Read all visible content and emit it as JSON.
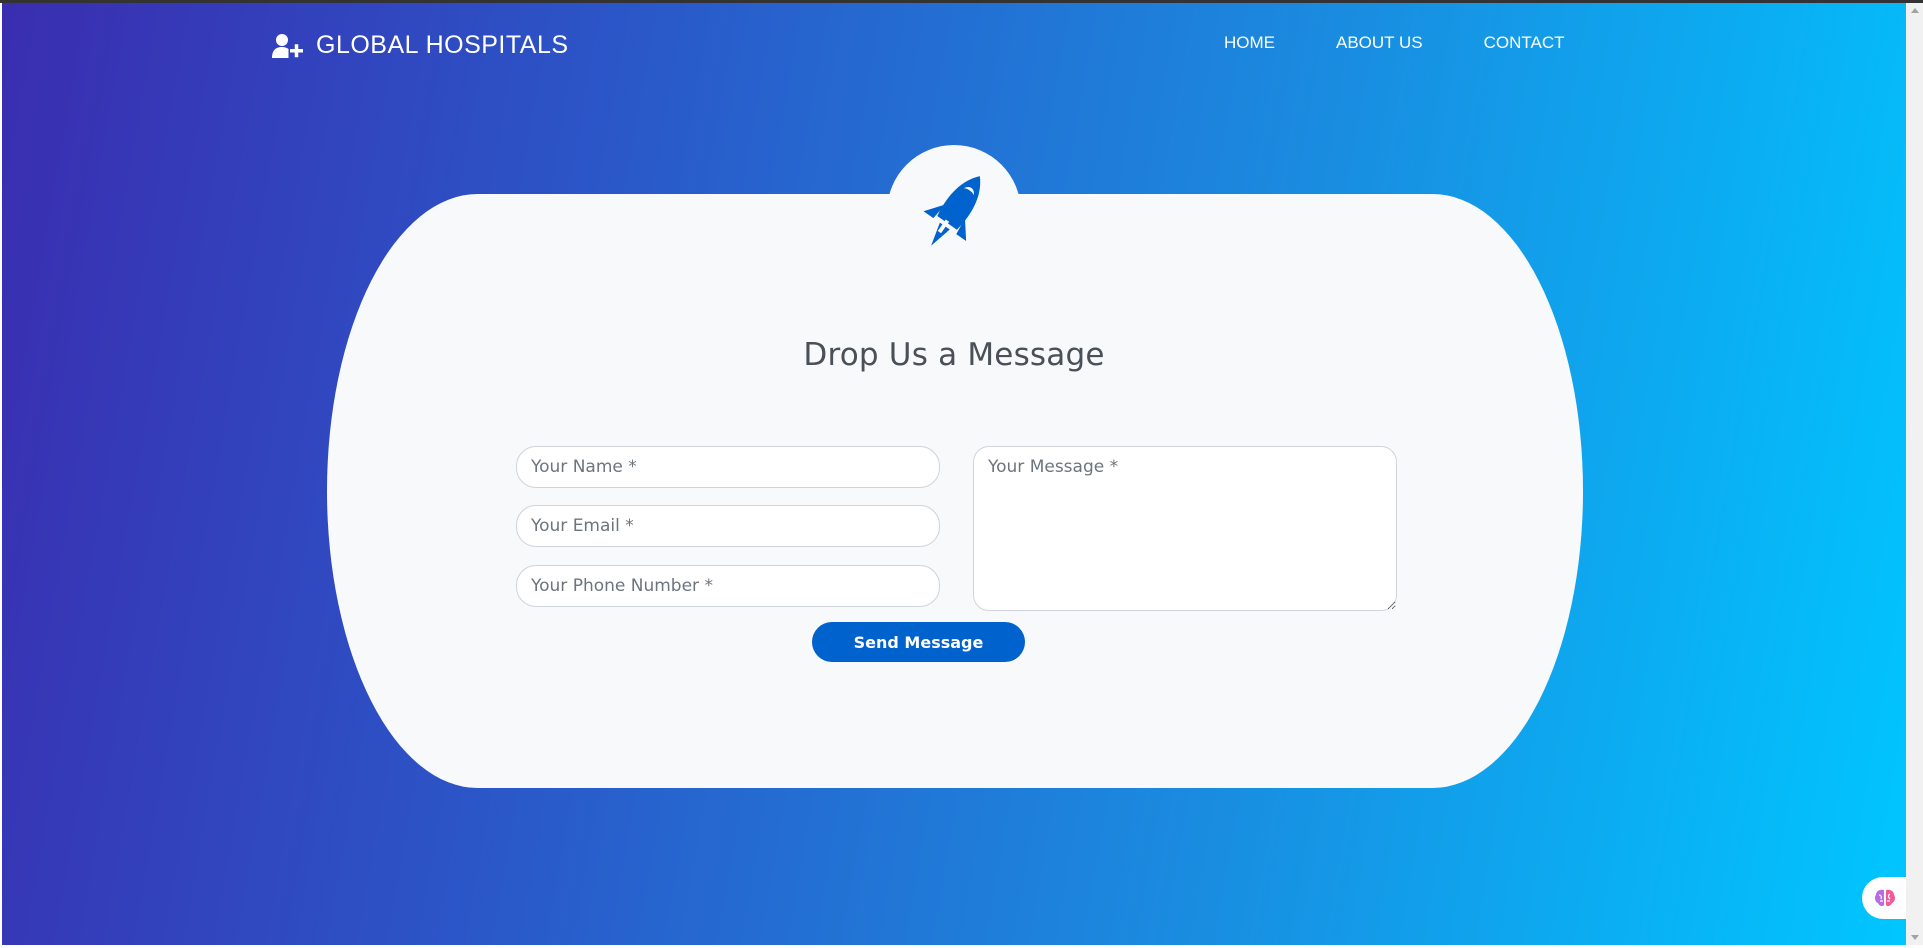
{
  "brand": {
    "name": "GLOBAL HOSPITALS",
    "icon": "user-plus-icon"
  },
  "nav": {
    "items": [
      {
        "label": "HOME"
      },
      {
        "label": "ABOUT US"
      },
      {
        "label": "CONTACT"
      }
    ]
  },
  "contact_form": {
    "logo_icon": "rocket-icon",
    "title": "Drop Us a Message",
    "name_placeholder": "Your Name *",
    "email_placeholder": "Your Email *",
    "phone_placeholder": "Your Phone Number *",
    "message_placeholder": "Your Message *",
    "submit_label": "Send Message"
  },
  "widgets": {
    "assistant_icon": "brain-icon"
  },
  "colors": {
    "gradient_start": "#3a2db0",
    "gradient_end": "#00c6ff",
    "card_background": "#f8f9fa",
    "primary": "#0062cc",
    "title_text": "#495057"
  }
}
